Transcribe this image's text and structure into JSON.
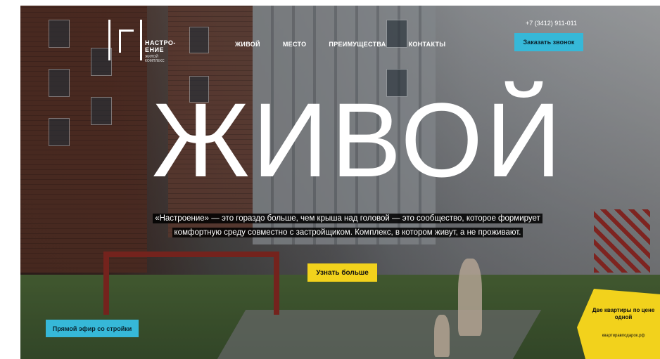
{
  "header": {
    "logo": {
      "name_line1": "НАСТРО-",
      "name_line2": "ЕНИЕ",
      "sub_line1": "ЖИЛОЙ",
      "sub_line2": "КОМПЛЕКС"
    },
    "nav": [
      "ЖИВОЙ",
      "МЕСТО",
      "ПРЕИМУЩЕСТВА",
      "КОНТАКТЫ"
    ],
    "phone": "+7 (3412) 911-011",
    "call_button": "Заказать звонок"
  },
  "hero": {
    "headline": "ЖИВОЙ",
    "description": "«Настроение» — это гораздо больше, чем крыша над головой — это сообщество, которое формирует комфортную среду совместно с застройщиком. Комплекс, в котором живут, а не проживают.",
    "more_button": "Узнать больше"
  },
  "live_button": "Прямой эфир со стройки",
  "promo": {
    "title": "Две квартиры по цене одной",
    "link": "квартиравподарок.рф"
  },
  "colors": {
    "accent_blue": "#36b8d8",
    "accent_yellow": "#f2d21c"
  }
}
